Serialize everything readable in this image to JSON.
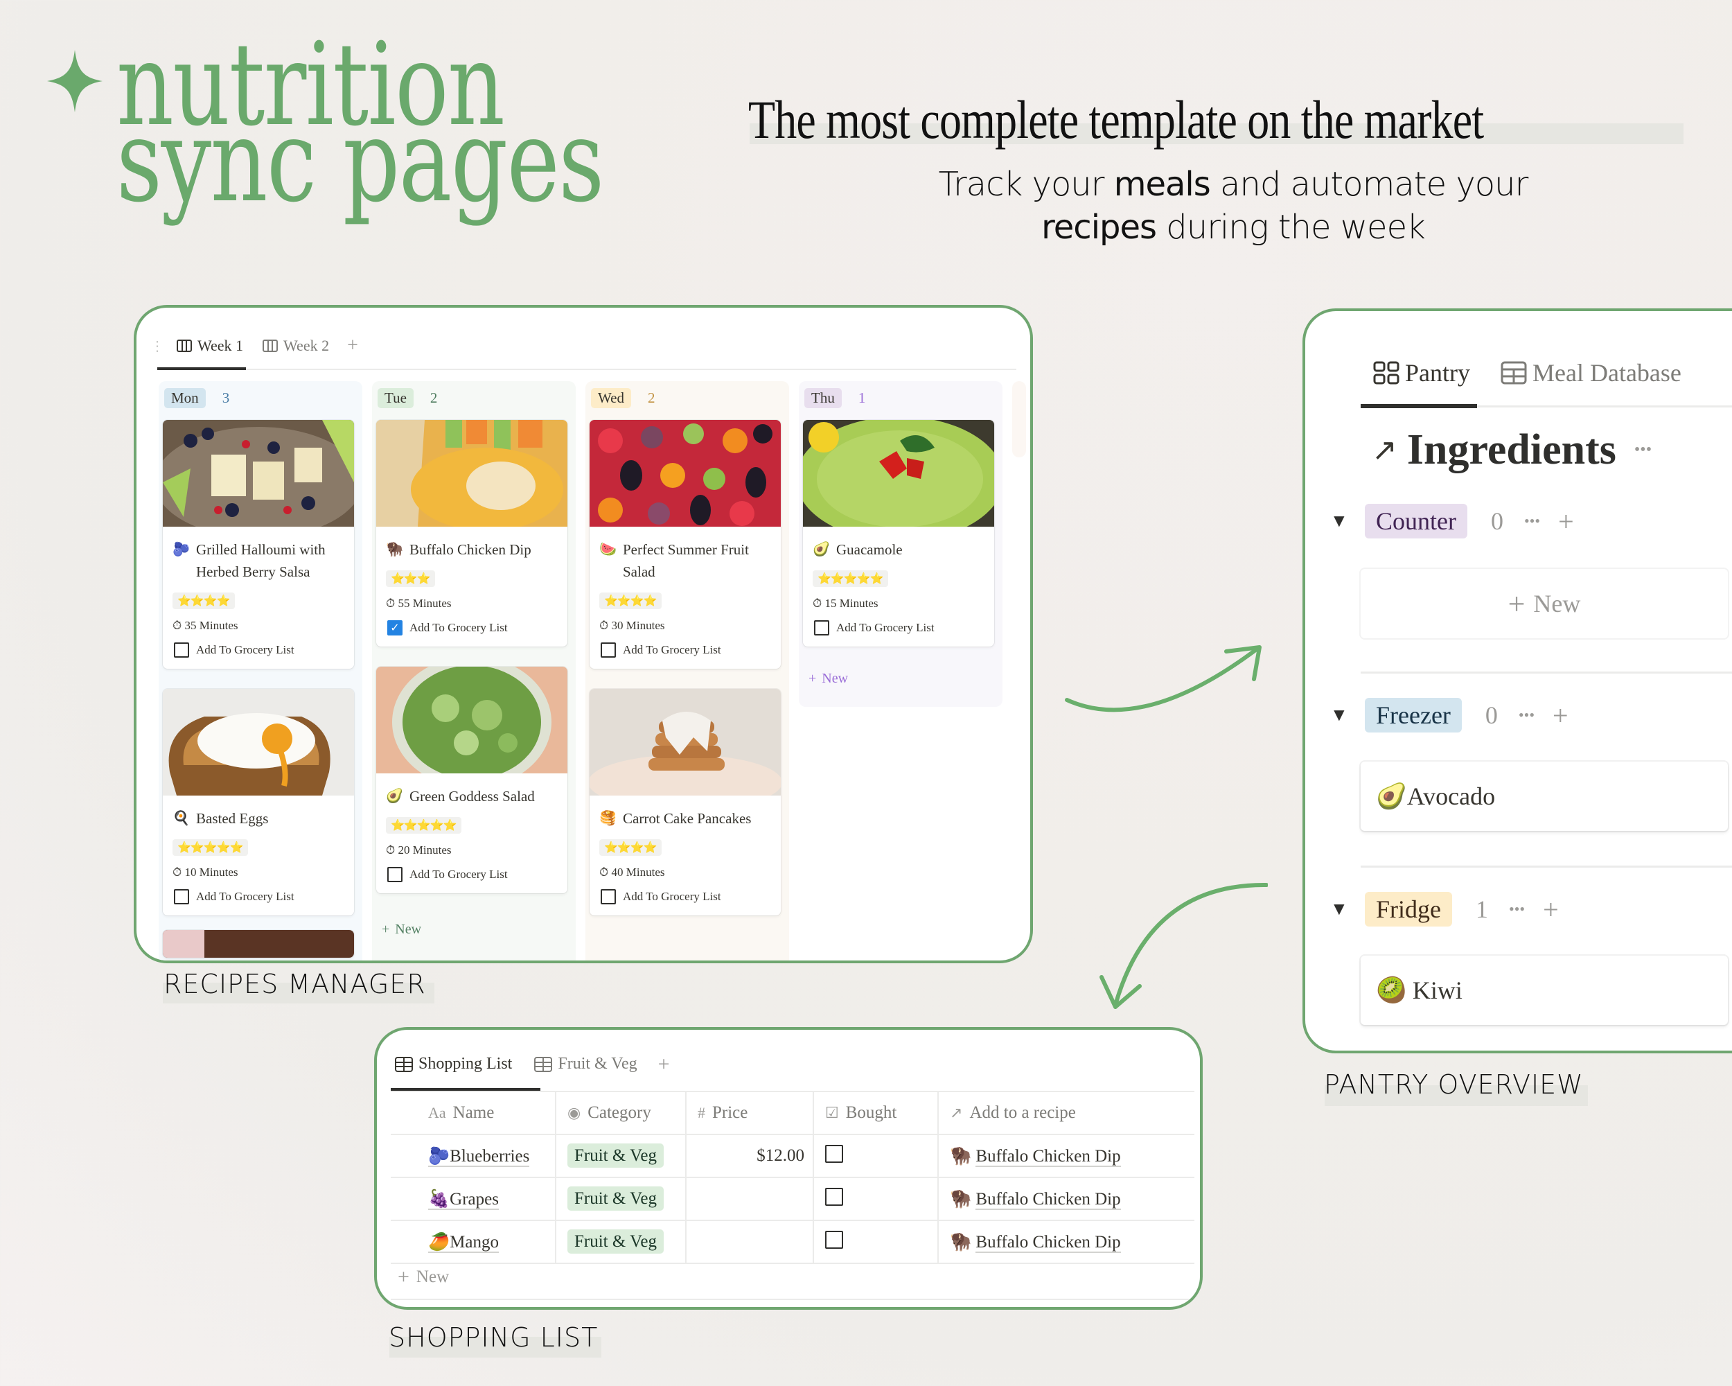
{
  "brand": {
    "star_icon": "four-point-sparkle",
    "line1": "nutrition",
    "line2": "sync pages",
    "color": "#6aa96c"
  },
  "tagline": "The most complete template on the market",
  "subtagline": {
    "p1": "Track your ",
    "b1": "meals",
    "p2": " and automate your",
    "b2": "recipes",
    "p3": " during the week"
  },
  "recipes": {
    "caption": "RECIPES MANAGER",
    "tabs": [
      {
        "label": "Week 1",
        "icon": "board-icon",
        "active": true
      },
      {
        "label": "Week 2",
        "icon": "board-icon",
        "active": false
      }
    ],
    "add_tab": "+",
    "columns": [
      {
        "day": "Mon",
        "count": "3",
        "pill_bg": "#d3e5ef",
        "count_color": "#487ca5",
        "bg": "#f5f9fc",
        "cards": [
          {
            "emoji": "🫐",
            "title": "Grilled Halloumi with Herbed Berry Salsa",
            "stars": "⭐⭐⭐⭐",
            "rating": 4,
            "minutes": "35 Minutes",
            "grocery_label": "Add To Grocery List",
            "in_grocery": false
          },
          {
            "emoji": "🍳",
            "title": "Basted Eggs",
            "stars": "⭐⭐⭐⭐⭐",
            "rating": 5,
            "minutes": "10 Minutes",
            "grocery_label": "Add To Grocery List",
            "in_grocery": false
          }
        ]
      },
      {
        "day": "Tue",
        "count": "2",
        "pill_bg": "#dbeddb",
        "count_color": "#548164",
        "bg": "#f6f9f6",
        "cards": [
          {
            "emoji": "🦬",
            "title": "Buffalo Chicken Dip",
            "stars": "⭐⭐⭐",
            "rating": 3,
            "minutes": "55 Minutes",
            "grocery_label": "Add To Grocery List",
            "in_grocery": true
          },
          {
            "emoji": "🥑",
            "title": "Green Goddess Salad",
            "stars": "⭐⭐⭐⭐⭐",
            "rating": 5,
            "minutes": "20 Minutes",
            "grocery_label": "Add To Grocery List",
            "in_grocery": false
          }
        ],
        "new_label": "New"
      },
      {
        "day": "Wed",
        "count": "2",
        "pill_bg": "#fdecc8",
        "count_color": "#c29343",
        "bg": "#fbf8f3",
        "cards": [
          {
            "emoji": "🍉",
            "title": "Perfect Summer Fruit Salad",
            "stars": "⭐⭐⭐⭐",
            "rating": 4,
            "minutes": "30 Minutes",
            "grocery_label": "Add To Grocery List",
            "in_grocery": false
          },
          {
            "emoji": "🥞",
            "title": "Carrot Cake Pancakes",
            "stars": "⭐⭐⭐⭐",
            "rating": 4,
            "minutes": "40 Minutes",
            "grocery_label": "Add To Grocery List",
            "in_grocery": false
          }
        ]
      },
      {
        "day": "Thu",
        "count": "1",
        "pill_bg": "#e8deee",
        "count_color": "#9a6dd7",
        "bg": "#f8f7fb",
        "cards": [
          {
            "emoji": "🥑",
            "title": "Guacamole",
            "stars": "⭐⭐⭐⭐⭐",
            "rating": 5,
            "minutes": "15 Minutes",
            "grocery_label": "Add To Grocery List",
            "in_grocery": false
          }
        ],
        "new_label": "New"
      }
    ]
  },
  "pantry": {
    "caption": "PANTRY OVERVIEW",
    "tabs": [
      {
        "label": "Pantry",
        "icon": "gallery-icon",
        "active": true
      },
      {
        "label": "Meal Database",
        "icon": "table-icon",
        "active": false
      }
    ],
    "title": "Ingredients",
    "title_icon": "↗",
    "more": "•••",
    "groups": [
      {
        "name": "Counter",
        "count": "0",
        "pill_bg": "#e8deee",
        "pill_color": "#412454",
        "items": [],
        "new_label": "New"
      },
      {
        "name": "Freezer",
        "count": "0",
        "pill_bg": "#d3e5ef",
        "pill_color": "#183347",
        "items": [
          {
            "emoji": "🥑",
            "name": "Avocado"
          }
        ]
      },
      {
        "name": "Fridge",
        "count": "1",
        "pill_bg": "#fdecc8",
        "pill_color": "#402c1b",
        "items": [
          {
            "emoji": "🥝",
            "name": "Kiwi"
          }
        ]
      }
    ]
  },
  "shopping": {
    "caption": "SHOPPING LIST",
    "tabs": [
      {
        "label": "Shopping List",
        "icon": "table-icon",
        "active": true
      },
      {
        "label": "Fruit & Veg",
        "icon": "table-icon",
        "active": false
      }
    ],
    "columns": [
      {
        "label": "Name",
        "icon": "Aa"
      },
      {
        "label": "Category",
        "icon": "◉"
      },
      {
        "label": "Price",
        "icon": "#"
      },
      {
        "label": "Bought",
        "icon": "☑"
      },
      {
        "label": "Add to a recipe",
        "icon": "↗"
      }
    ],
    "rows": [
      {
        "emoji": "🫐",
        "name": "Blueberries",
        "category": "Fruit & Veg",
        "price": "$12.00",
        "bought": false,
        "recipe_emoji": "🦬",
        "recipe": "Buffalo Chicken Dip"
      },
      {
        "emoji": "🍇",
        "name": "Grapes",
        "category": "Fruit & Veg",
        "price": "",
        "bought": false,
        "recipe_emoji": "🦬",
        "recipe": "Buffalo Chicken Dip"
      },
      {
        "emoji": "🥭",
        "name": "Mango",
        "category": "Fruit & Veg",
        "price": "",
        "bought": false,
        "recipe_emoji": "🦬",
        "recipe": "Buffalo Chicken Dip"
      }
    ],
    "new_label": "New"
  }
}
